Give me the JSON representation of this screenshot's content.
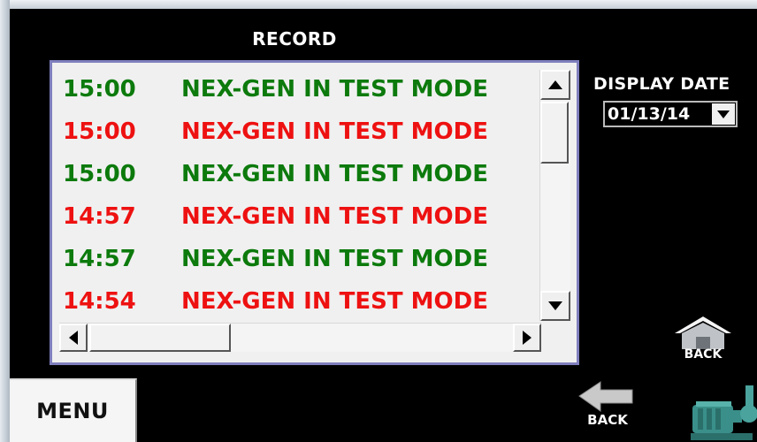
{
  "title": "RECORD",
  "records": [
    {
      "time": "15:00",
      "message": "NEX-GEN IN TEST MODE",
      "color": "#0c7a0c"
    },
    {
      "time": "15:00",
      "message": "NEX-GEN IN TEST MODE",
      "color": "#ee1111"
    },
    {
      "time": "15:00",
      "message": "NEX-GEN IN TEST MODE",
      "color": "#0c7a0c"
    },
    {
      "time": "14:57",
      "message": "NEX-GEN IN TEST MODE",
      "color": "#ee1111"
    },
    {
      "time": "14:57",
      "message": "NEX-GEN IN TEST MODE",
      "color": "#0c7a0c"
    },
    {
      "time": "14:54",
      "message": "NEX-GEN IN TEST MODE",
      "color": "#ee1111"
    }
  ],
  "display_date": {
    "label": "DISPLAY DATE",
    "value": "01/13/14"
  },
  "buttons": {
    "menu": "MENU",
    "back": "BACK",
    "home_back": "BACK"
  },
  "icons": {
    "home_back": "home-icon",
    "back": "left-arrow-icon",
    "pump": "pump-icon"
  }
}
